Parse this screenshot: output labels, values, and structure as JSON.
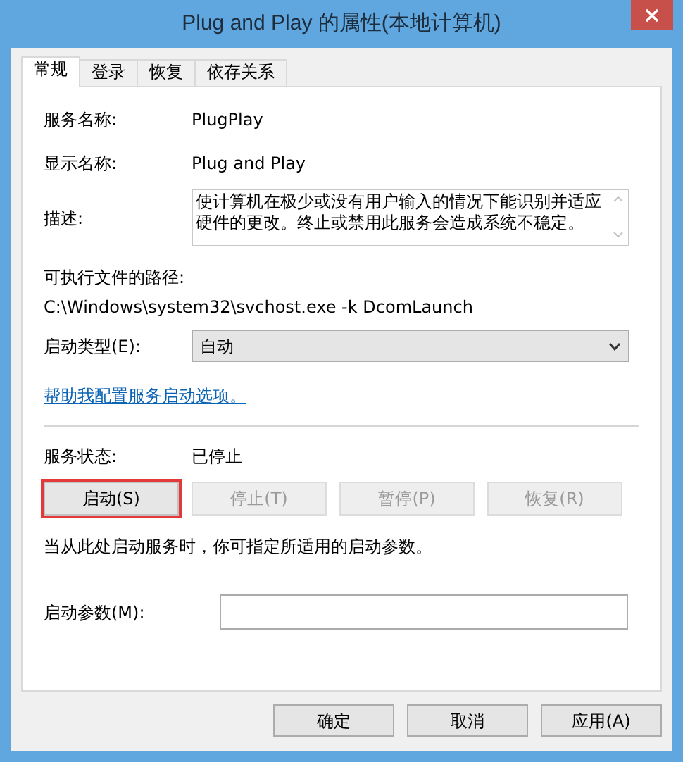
{
  "window": {
    "title": "Plug and Play 的属性(本地计算机)"
  },
  "tabs": [
    {
      "label": "常规",
      "selected": true
    },
    {
      "label": "登录",
      "selected": false
    },
    {
      "label": "恢复",
      "selected": false
    },
    {
      "label": "依存关系",
      "selected": false
    }
  ],
  "service_name": {
    "label": "服务名称:",
    "value": "PlugPlay"
  },
  "display_name": {
    "label": "显示名称:",
    "value": "Plug and Play"
  },
  "description": {
    "label": "描述:",
    "value": "使计算机在极少或没有用户输入的情况下能识别并适应硬件的更改。终止或禁用此服务会造成系统不稳定。"
  },
  "executable_path": {
    "label": "可执行文件的路径:",
    "value": "C:\\Windows\\system32\\svchost.exe -k DcomLaunch"
  },
  "startup_type": {
    "label": "启动类型(E):",
    "value": "自动"
  },
  "help_link": "帮助我配置服务启动选项。",
  "service_status": {
    "label": "服务状态:",
    "value": "已停止"
  },
  "service_buttons": [
    {
      "label": "启动(S)",
      "disabled": false,
      "highlighted": true
    },
    {
      "label": "停止(T)",
      "disabled": true,
      "highlighted": false
    },
    {
      "label": "暂停(P)",
      "disabled": true,
      "highlighted": false
    },
    {
      "label": "恢复(R)",
      "disabled": true,
      "highlighted": false
    }
  ],
  "note": "当从此处启动服务时，你可指定所适用的启动参数。",
  "start_parameters": {
    "label": "启动参数(M):"
  },
  "dialog_buttons": [
    "确定",
    "取消",
    "应用(A)"
  ]
}
